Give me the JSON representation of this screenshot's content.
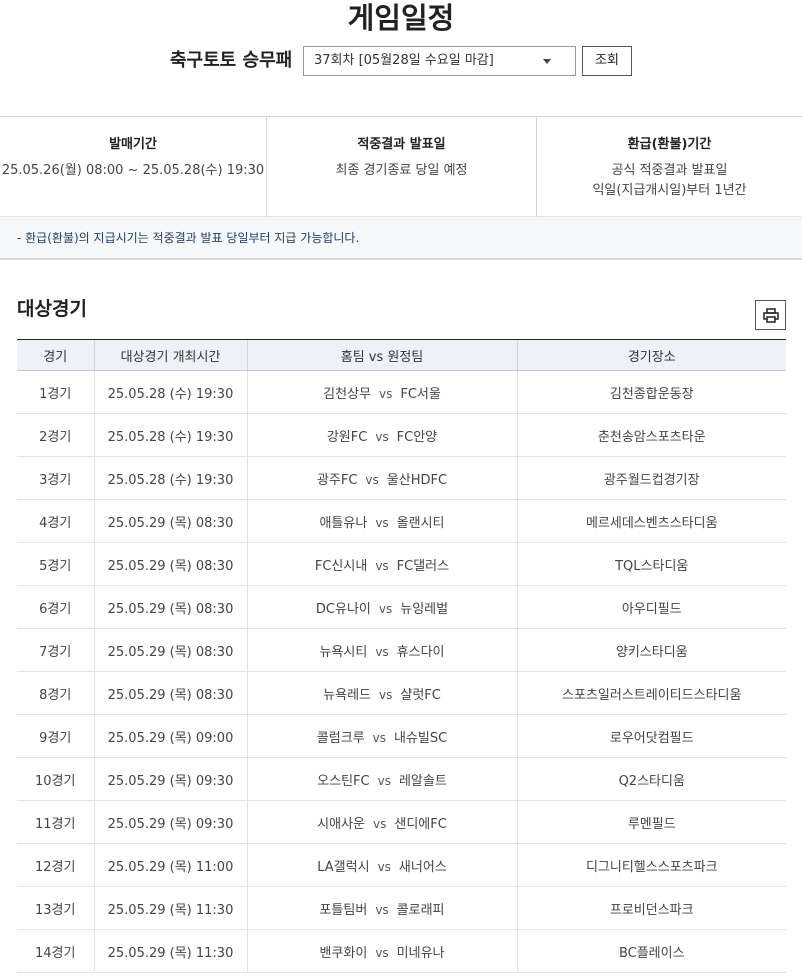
{
  "page": {
    "title": "게임일정"
  },
  "selector": {
    "game_name": "축구토토 승무패",
    "round_value": "37회차 [05월28일 수요일 마감]",
    "search_label": "조회"
  },
  "info": {
    "sale_period": {
      "label": "발매기간",
      "value": "25.05.26(월) 08:00 ~ 25.05.28(수) 19:30"
    },
    "result_announce": {
      "label": "적중결과 발표일",
      "value": "최종 경기종료 당일 예정"
    },
    "refund_period": {
      "label": "환급(환불)기간",
      "value_line1": "공식 적중결과 발표일",
      "value_line2": "익일(지급개시일)부터 1년간"
    }
  },
  "notice": "- 환급(환불)의 지급시기는 적중결과 발표 당일부터 지급 가능합니다.",
  "section": {
    "title": "대상경기",
    "print_icon": "printer-icon"
  },
  "table": {
    "headers": {
      "game": "경기",
      "time": "대상경기 개최시간",
      "teams": "홈팀  vs  원정팀",
      "venue": "경기장소"
    },
    "vs_label": "vs",
    "rows": [
      {
        "game": "1경기",
        "time": "25.05.28 (수) 19:30",
        "home": "김천상무",
        "away": "FC서울",
        "venue": "김천종합운동장"
      },
      {
        "game": "2경기",
        "time": "25.05.28 (수) 19:30",
        "home": "강원FC",
        "away": "FC안양",
        "venue": "춘천송암스포츠타운"
      },
      {
        "game": "3경기",
        "time": "25.05.28 (수) 19:30",
        "home": "광주FC",
        "away": "울산HDFC",
        "venue": "광주월드컵경기장"
      },
      {
        "game": "4경기",
        "time": "25.05.29 (목) 08:30",
        "home": "애틀유나",
        "away": "올랜시티",
        "venue": "메르세데스벤츠스타디움"
      },
      {
        "game": "5경기",
        "time": "25.05.29 (목) 08:30",
        "home": "FC신시내",
        "away": "FC댈러스",
        "venue": "TQL스타디움"
      },
      {
        "game": "6경기",
        "time": "25.05.29 (목) 08:30",
        "home": "DC유나이",
        "away": "뉴잉레벌",
        "venue": "아우디필드"
      },
      {
        "game": "7경기",
        "time": "25.05.29 (목) 08:30",
        "home": "뉴욕시티",
        "away": "휴스다이",
        "venue": "양키스타디움"
      },
      {
        "game": "8경기",
        "time": "25.05.29 (목) 08:30",
        "home": "뉴욕레드",
        "away": "샬럿FC",
        "venue": "스포츠일러스트레이티드스타디움"
      },
      {
        "game": "9경기",
        "time": "25.05.29 (목) 09:00",
        "home": "콜럼크루",
        "away": "내슈빌SC",
        "venue": "로우어닷컴필드"
      },
      {
        "game": "10경기",
        "time": "25.05.29 (목) 09:30",
        "home": "오스틴FC",
        "away": "레알솔트",
        "venue": "Q2스타디움"
      },
      {
        "game": "11경기",
        "time": "25.05.29 (목) 09:30",
        "home": "시애사운",
        "away": "샌디에FC",
        "venue": "루멘필드"
      },
      {
        "game": "12경기",
        "time": "25.05.29 (목) 11:00",
        "home": "LA갤럭시",
        "away": "새너어스",
        "venue": "디그니티헬스스포츠파크"
      },
      {
        "game": "13경기",
        "time": "25.05.29 (목) 11:30",
        "home": "포틀팀버",
        "away": "콜로래피",
        "venue": "프로비던스파크"
      },
      {
        "game": "14경기",
        "time": "25.05.29 (목) 11:30",
        "home": "밴쿠화이",
        "away": "미네유나",
        "venue": "BC플레이스"
      }
    ]
  }
}
